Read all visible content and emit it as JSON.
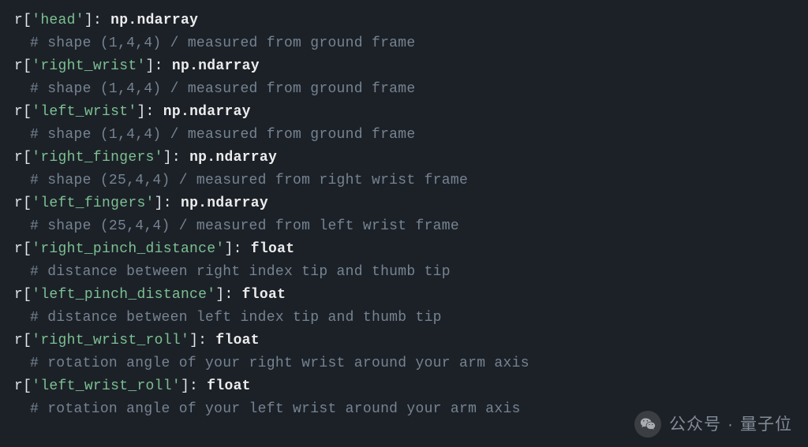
{
  "entries": [
    {
      "key": "'head'",
      "type": "np.ndarray",
      "comment": "# shape (1,4,4) / measured from ground frame"
    },
    {
      "key": "'right_wrist'",
      "type": "np.ndarray",
      "comment": "# shape (1,4,4) / measured from ground frame"
    },
    {
      "key": "'left_wrist'",
      "type": "np.ndarray",
      "comment": "# shape (1,4,4) / measured from ground frame"
    },
    {
      "key": "'right_fingers'",
      "type": "np.ndarray",
      "comment": "# shape (25,4,4) / measured from right wrist frame"
    },
    {
      "key": "'left_fingers'",
      "type": "np.ndarray",
      "comment": "# shape (25,4,4) / measured from left wrist frame"
    },
    {
      "key": "'right_pinch_distance'",
      "type": "float",
      "comment": "# distance between right index tip and thumb tip"
    },
    {
      "key": "'left_pinch_distance'",
      "type": "float",
      "comment": "# distance between left index tip and thumb tip"
    },
    {
      "key": "'right_wrist_roll'",
      "type": "float",
      "comment": "# rotation angle of your right wrist around your arm axis"
    },
    {
      "key": "'left_wrist_roll'",
      "type": "float",
      "comment": "# rotation angle of your left wrist around your arm axis"
    }
  ],
  "watermark": {
    "label1": "公众号",
    "dot": "·",
    "label2": "量子位"
  }
}
